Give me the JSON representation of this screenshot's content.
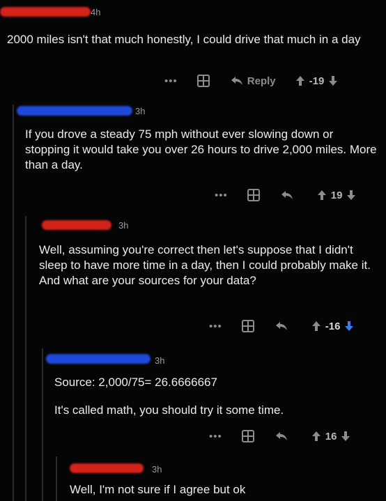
{
  "comments": [
    {
      "time": "4h",
      "text": "2000 miles isn't that much honestly, I could drive that much in a day",
      "reply_label": "Reply",
      "score": "-19",
      "user_color": "#d4231b"
    },
    {
      "time": "3h",
      "text": "If you drove a steady 75 mph without ever slowing down or stopping it would take you over 26 hours to drive 2,000 miles. More than a day.",
      "score": "19",
      "user_color": "#1f49d8"
    },
    {
      "time": "3h",
      "text": "Well, assuming you're correct then let's suppose that I didn't sleep to have more time in a day, then I could probably make it. And what are your sources for your data?",
      "score": "-16",
      "user_color": "#d4231b"
    },
    {
      "time": "3h",
      "text_line1": "Source: 2,000/75= 26.6666667",
      "text_line2": "It's called math, you should try it some time.",
      "score": "16",
      "user_color": "#1f49d8"
    },
    {
      "time": "3h",
      "text": "Well, I'm not sure if I agree but ok",
      "user_color": "#d4231b"
    }
  ],
  "icons": {
    "more": "more-icon",
    "award": "award-icon",
    "reply": "reply-icon",
    "upvote": "upvote-icon",
    "downvote": "downvote-icon"
  }
}
